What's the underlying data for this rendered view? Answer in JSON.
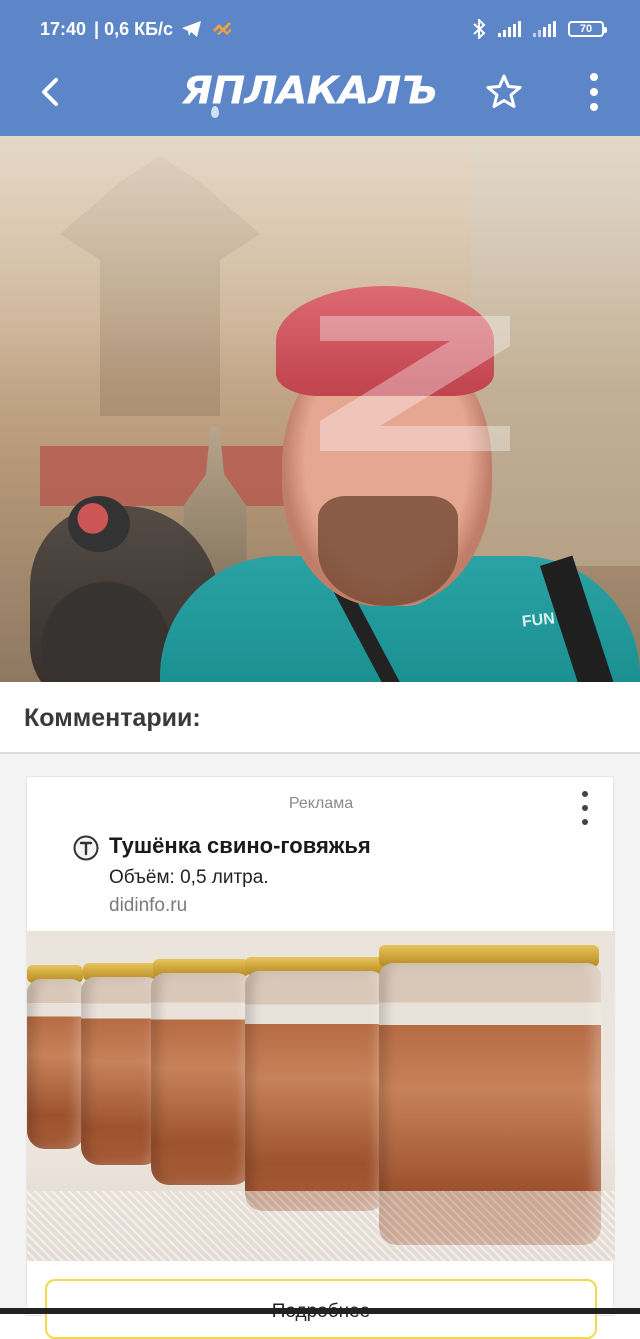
{
  "status_bar": {
    "time": "17:40",
    "network_speed": "| 0,6 КБ/с",
    "battery": "70"
  },
  "app_bar": {
    "logo_text": "ЯПЛАКАЛЪ",
    "accent_color": "#5d86c9"
  },
  "hero": {
    "shirt_text": "FUN"
  },
  "comments": {
    "heading": "Комментарии:"
  },
  "ad": {
    "label": "Реклама",
    "title": "Тушёнка свино-говяжья",
    "description": "Объём: 0,5 литра.",
    "domain": "didinfo.ru",
    "cta": "Подробнее",
    "cta_border_color": "#f2d94a"
  }
}
